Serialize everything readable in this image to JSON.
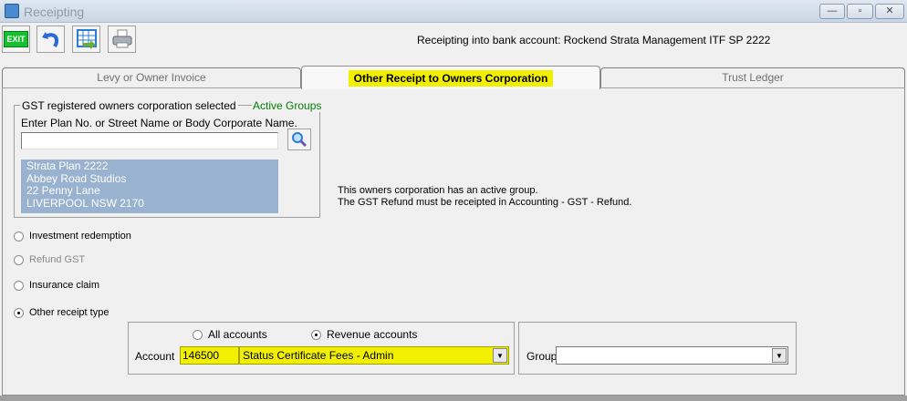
{
  "window": {
    "title": "Receipting",
    "controls": {
      "minimize": "—",
      "maximize": "▫",
      "close": "✕"
    }
  },
  "toolbar": {
    "exit_label": "EXIT",
    "icons": [
      "exit-icon",
      "undo-icon",
      "calendar-export-icon",
      "printer-icon"
    ],
    "bank_text": "Receipting into bank account: Rockend Strata Management ITF SP 2222"
  },
  "tabs": [
    {
      "label": "Levy or Owner Invoice"
    },
    {
      "label": "Other Receipt to Owners Corporation",
      "active": true
    },
    {
      "label": "Trust Ledger"
    }
  ],
  "gst_group": {
    "legend": "GST registered owners corporation selected",
    "active_groups": "Active Groups",
    "search_label": "Enter Plan No. or Street Name or Body Corporate Name.",
    "search_value": "",
    "address": [
      "Strata Plan 2222",
      "Abbey Road Studios",
      "22 Penny Lane",
      "LIVERPOOL  NSW  2170"
    ]
  },
  "messages": [
    "This owners corporation has an active group.",
    "The GST Refund must be receipted in Accounting - GST - Refund."
  ],
  "receipt_types": [
    {
      "label": "Investment redemption",
      "checked": false,
      "disabled": false
    },
    {
      "label": "Refund GST",
      "checked": false,
      "disabled": true
    },
    {
      "label": "Insurance claim",
      "checked": false,
      "disabled": false
    },
    {
      "label": "Other receipt type",
      "checked": true,
      "disabled": false
    }
  ],
  "account_box": {
    "filters": [
      {
        "label": "All accounts",
        "checked": false
      },
      {
        "label": "Revenue accounts",
        "checked": true
      }
    ],
    "account_label": "Account",
    "account_code": "146500",
    "account_name": "Status Certificate Fees - Admin"
  },
  "group_box": {
    "label": "Group",
    "value": ""
  },
  "colors": {
    "highlight": "#f2f000",
    "address_bg": "#98b2d0",
    "active_groups": "#008000"
  }
}
